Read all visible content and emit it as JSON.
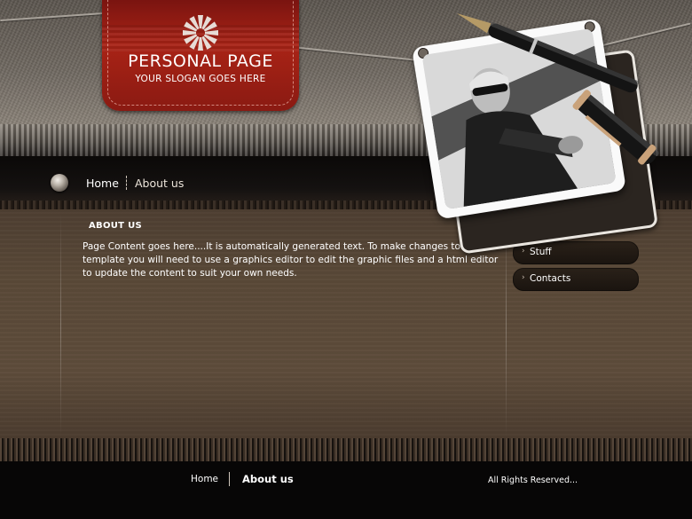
{
  "header": {
    "title": "PERSONAL PAGE",
    "slogan": "YOUR SLOGAN GOES HERE",
    "logo_icon": "pinwheel-icon"
  },
  "nav": {
    "items": [
      {
        "label": "Home"
      },
      {
        "label": "About us"
      }
    ]
  },
  "content": {
    "heading": "ABOUT US",
    "body": "Page Content goes here....It is automatically generated text. To make changes to this template you will need to use a graphics editor to edit the graphic files and a html editor to update the content to suit your own needs."
  },
  "sidebar": {
    "items": [
      {
        "label": "Stuff"
      },
      {
        "label": "Contacts"
      }
    ]
  },
  "footer": {
    "links": [
      {
        "label": "Home"
      },
      {
        "label": "About us"
      }
    ],
    "copyright": "All Rights Reserved..."
  },
  "colors": {
    "tag_red": "#a92316",
    "content_brown": "#5a4938",
    "nav_dark": "#141110"
  }
}
